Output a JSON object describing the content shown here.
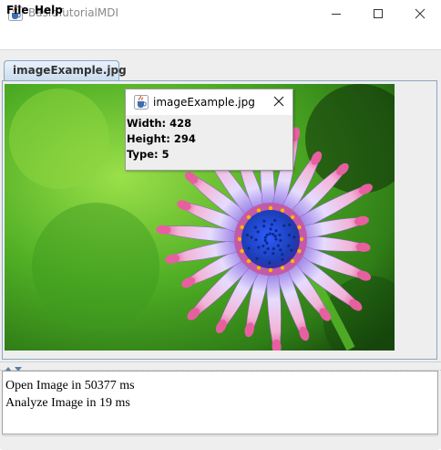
{
  "window": {
    "title": "BasicTutorialMDI",
    "icon": "java-cup-icon",
    "controls": [
      "minimize-icon",
      "maximize-icon",
      "close-icon"
    ]
  },
  "menu": {
    "items": [
      {
        "label": "File"
      },
      {
        "label": "Help"
      }
    ]
  },
  "tabs": [
    {
      "label": "imageExample.jpg",
      "selected": true
    }
  ],
  "internal_frame": {
    "title": "imageExample.jpg",
    "icon": "java-cup-icon",
    "lines": [
      "Width: 428",
      "Height: 294",
      "Type: 5"
    ]
  },
  "log": {
    "lines": [
      "Open Image in 50377 ms",
      "Analyze Image in 19 ms"
    ]
  },
  "image": {
    "subject": "flower-photo"
  },
  "colors": {
    "tab_border": "#8aa6c1",
    "background": "#eeeeee",
    "petal_pink": "#e85fa0",
    "center_blue": "#1c3fb8"
  }
}
